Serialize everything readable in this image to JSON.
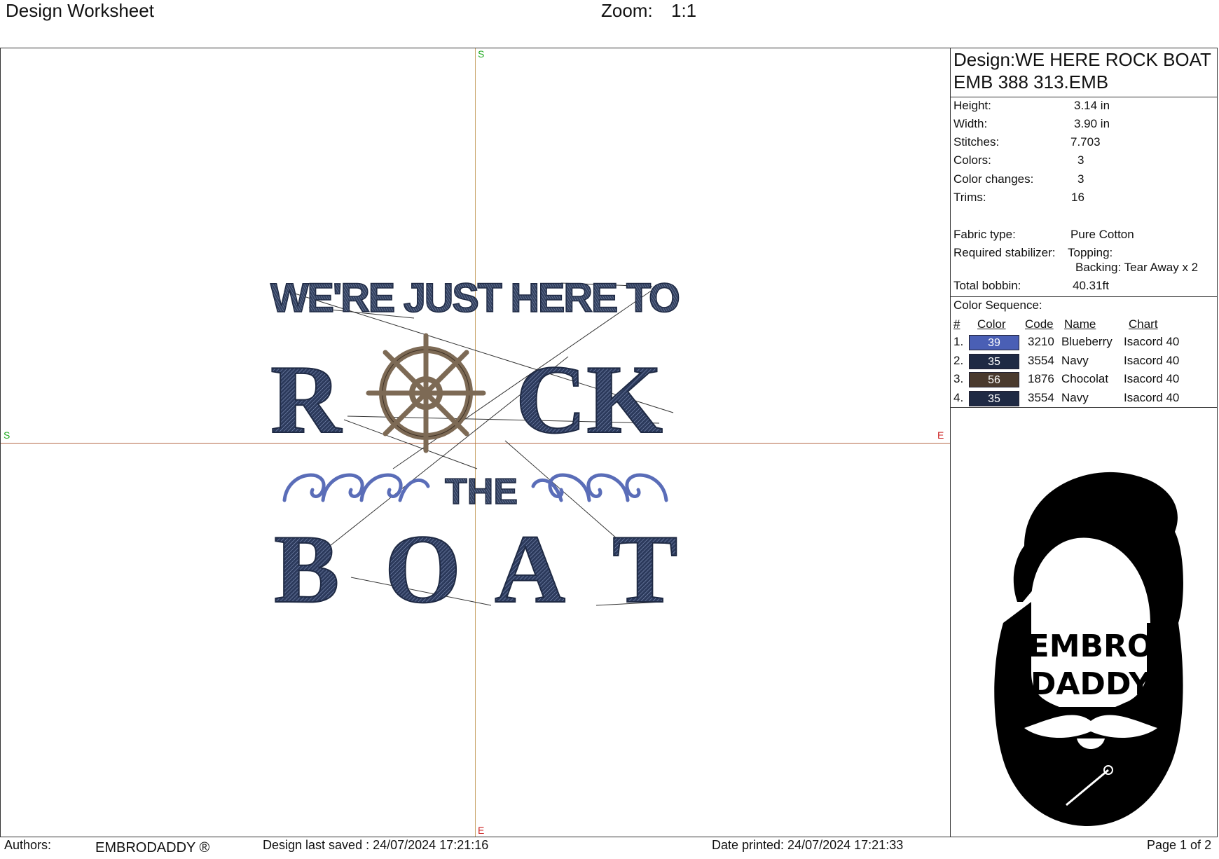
{
  "header": {
    "title": "Design Worksheet",
    "zoom_label": "Zoom:",
    "zoom_value": "1:1"
  },
  "canvas": {
    "axis_marks": {
      "top": "S",
      "left": "S",
      "right": "E",
      "bottom": "E"
    },
    "design_text": {
      "line1": "WE'RE JUST HERE TO",
      "rock_r": "R",
      "rock_ck": "CK",
      "the": "THE",
      "boat": [
        "B",
        "O",
        "A",
        "T"
      ]
    }
  },
  "panel": {
    "design_name": "Design:WE HERE ROCK BOAT EMB 388 313.EMB",
    "specs": [
      {
        "label": "Height:",
        "value": "3.14 in"
      },
      {
        "label": "Width:",
        "value": "3.90 in"
      },
      {
        "label": "Stitches:",
        "value": "7.703"
      },
      {
        "label": "Colors:",
        "value": "3"
      },
      {
        "label": "Color changes:",
        "value": "3"
      },
      {
        "label": "Trims:",
        "value": "16"
      }
    ],
    "fabric_label": "Fabric type:",
    "fabric_value": "Pure Cotton",
    "stabilizer_label": "Required stabilizer:",
    "topping_value": "Topping:",
    "backing_value": "Backing: Tear Away x 2",
    "bobbin_label": "Total bobbin:",
    "bobbin_value": "40.31ft",
    "color_sequence_title": "Color Sequence:",
    "sequence_headers": {
      "num": "#",
      "color": "Color",
      "code": "Code",
      "name": "Name",
      "chart": "Chart"
    },
    "colors": [
      {
        "num": "1.",
        "swatch_label": "39",
        "hex": "#4a5fb5",
        "code": "3210",
        "name": "Blueberry",
        "chart": "Isacord 40"
      },
      {
        "num": "2.",
        "swatch_label": "35",
        "hex": "#1f2a44",
        "code": "3554",
        "name": "Navy",
        "chart": "Isacord 40"
      },
      {
        "num": "3.",
        "swatch_label": "56",
        "hex": "#4a3a2e",
        "code": "1876",
        "name": "Chocolat",
        "chart": "Isacord 40"
      },
      {
        "num": "4.",
        "swatch_label": "35",
        "hex": "#1f2a44",
        "code": "3554",
        "name": "Navy",
        "chart": "Isacord 40"
      }
    ],
    "logo_text": {
      "line1": "EMBRO",
      "line2": "DADDY"
    }
  },
  "footer": {
    "authors_label": "Authors:",
    "authors_value": "EMBRODADDY ®",
    "saved": "Design last saved : 24/07/2024 17:21:16",
    "printed": "Date printed: 24/07/2024 17:21:33",
    "page": "Page 1 of 2"
  }
}
